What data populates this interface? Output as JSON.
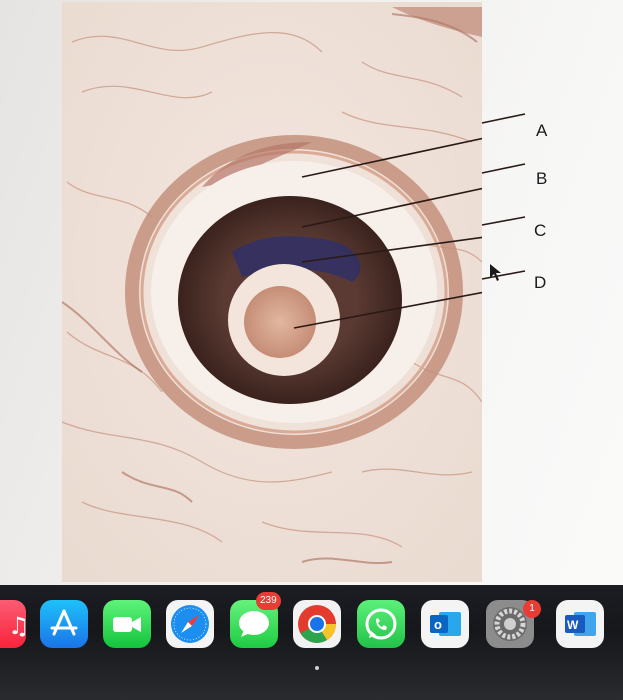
{
  "figure": {
    "labels": [
      "A",
      "B",
      "C",
      "D"
    ]
  },
  "dock": {
    "items": [
      {
        "name": "music-app-icon"
      },
      {
        "name": "app-store-icon"
      },
      {
        "name": "facetime-icon"
      },
      {
        "name": "safari-icon"
      },
      {
        "name": "messages-icon",
        "badge": "239"
      },
      {
        "name": "chrome-icon"
      },
      {
        "name": "whatsapp-icon"
      },
      {
        "name": "outlook-icon"
      },
      {
        "name": "system-preferences-icon",
        "badge": "1"
      },
      {
        "name": "word-icon"
      }
    ]
  },
  "colors": {
    "dock": "#15171b",
    "badge": "#e83c34",
    "tissue_dark": "#3b2420",
    "tissue_outer": "#c79a86",
    "stain_blue": "#2b2f6e"
  }
}
